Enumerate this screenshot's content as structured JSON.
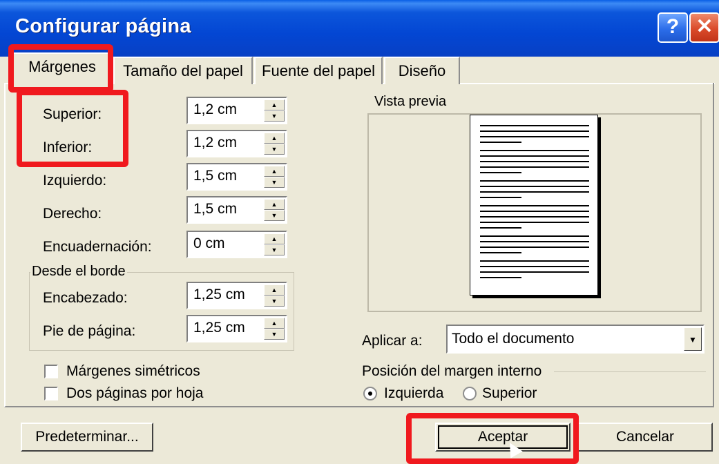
{
  "window": {
    "title": "Configurar página"
  },
  "tabs": [
    {
      "label": "Márgenes"
    },
    {
      "label": "Tamaño del papel"
    },
    {
      "label": "Fuente del papel"
    },
    {
      "label": "Diseño"
    }
  ],
  "margins": {
    "superior": {
      "label": "Superior:",
      "value": "1,2 cm"
    },
    "inferior": {
      "label": "Inferior:",
      "value": "1,2 cm"
    },
    "izquierdo": {
      "label": "Izquierdo:",
      "value": "1,5 cm"
    },
    "derecho": {
      "label": "Derecho:",
      "value": "1,5 cm"
    },
    "encuadernacion": {
      "label": "Encuadernación:",
      "value": "0 cm"
    }
  },
  "desde_borde": {
    "title": "Desde el borde",
    "encabezado": {
      "label": "Encabezado:",
      "value": "1,25 cm"
    },
    "pie": {
      "label": "Pie de página:",
      "value": "1,25 cm"
    }
  },
  "checkboxes": [
    {
      "label": "Márgenes simétricos",
      "checked": false
    },
    {
      "label": "Dos páginas por hoja",
      "checked": false
    }
  ],
  "preview": {
    "title": "Vista previa"
  },
  "apply": {
    "label": "Aplicar a:",
    "value": "Todo el documento"
  },
  "gutter": {
    "title": "Posición del margen interno",
    "options": [
      {
        "label": "Izquierda",
        "checked": true
      },
      {
        "label": "Superior",
        "checked": false
      }
    ]
  },
  "buttons": {
    "default": "Predeterminar...",
    "ok": "Aceptar",
    "cancel": "Cancelar"
  },
  "colors": {
    "titlebar": "#0346D3",
    "highlight": "#F0191E",
    "face": "#ECE9D8"
  },
  "icons": {
    "help": "question-mark",
    "close": "x",
    "spin_up": "up-arrow",
    "spin_down": "down-arrow",
    "dropdown": "down-arrow"
  }
}
